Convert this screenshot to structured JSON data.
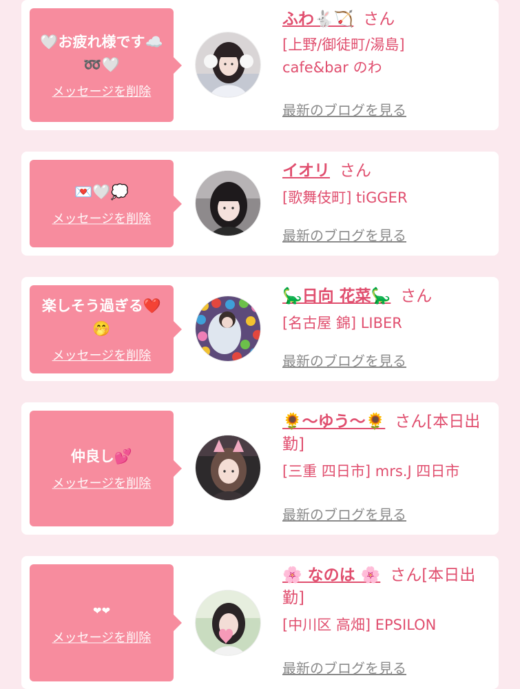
{
  "colors": {
    "accent_pink": "#f78c9e",
    "name_pink": "#e04e6e",
    "link_gray": "#8a8a8a",
    "page_bg": "#fbe9ee"
  },
  "items": [
    {
      "message": "🤍お疲れ様です☁️➿🤍",
      "delete_label": "メッセージを削除",
      "name": "ふわ🐇🏹",
      "honorific": "さん",
      "status": "",
      "shop": "[上野/御徒町/湯島] cafe&bar のわ",
      "blog_label": "最新のブログを見る",
      "avatar_icon": "avatar-photo-girl-white-earmuffs"
    },
    {
      "message": "💌🤍💭",
      "delete_label": "メッセージを削除",
      "name": "イオリ",
      "honorific": "さん",
      "status": "",
      "shop": "[歌舞伎町] tiGGER",
      "blog_label": "最新のブログを見る",
      "avatar_icon": "avatar-photo-girl-dark-hair"
    },
    {
      "message": "楽しそう過ぎる❤️🤭",
      "delete_label": "メッセージを削除",
      "name": "🦕日向 花菜🦕",
      "honorific": "さん",
      "status": "",
      "shop": "[名古屋 錦] LIBER",
      "blog_label": "最新のブログを見る",
      "avatar_icon": "avatar-photo-ball-pit"
    },
    {
      "message": "仲良し💕",
      "delete_label": "メッセージを削除",
      "name": "🌻〜ゆう〜🌻",
      "honorific": "さん",
      "status": "[本日出勤]",
      "shop": "[三重 四日市] mrs.J 四日市",
      "blog_label": "最新のブログを見る",
      "avatar_icon": "avatar-photo-girl-cat-ears"
    },
    {
      "message": "❤❤",
      "delete_label": "メッセージを削除",
      "name": "🌸 なのは 🌸",
      "honorific": "さん",
      "status": "[本日出勤]",
      "shop": "[中川区 高畑] EPSILON",
      "blog_label": "最新のブログを見る",
      "avatar_icon": "avatar-photo-girl-heart-sticker"
    }
  ]
}
